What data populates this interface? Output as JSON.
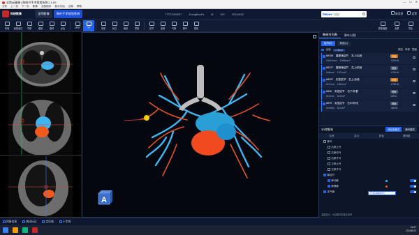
{
  "window": {
    "title": "全院云健康 | 肺结节手术规划系统 2.1.69",
    "controls": [
      "—",
      "☐",
      "✕"
    ]
  },
  "menu": [
    "文件",
    "上一页",
    "下一页",
    "影像",
    "全部插件",
    "显示对话",
    "注释",
    "帮助"
  ],
  "brand": {
    "name": "科研影像"
  },
  "app_tabs": [
    {
      "label": "全院影像"
    },
    {
      "label": "胸外手术规划系统"
    }
  ],
  "patient": {
    "id": "TT2C3493037",
    "name": "ZhangBaoFa",
    "sex": "M",
    "age": "45Y",
    "date": "2024/8/20"
  },
  "search": {
    "brand": "Meeex",
    "placeholder": "搜索..."
  },
  "top_right": [
    {
      "label": "新消息"
    },
    {
      "label": "设置"
    }
  ],
  "toolbar": [
    {
      "label": "布局"
    },
    {
      "label": "窗宽窗位"
    },
    {
      "label": "平移"
    },
    {
      "label": "缩放"
    },
    {
      "label": "旋转"
    },
    {
      "label": "反色"
    },
    {
      "label": "MPR"
    },
    {
      "label": "VR"
    },
    {
      "label": "测量"
    },
    {
      "label": "标注"
    },
    {
      "label": "裁剪"
    },
    {
      "label": "重置"
    },
    {
      "label": "结节"
    },
    {
      "label": "血管"
    },
    {
      "label": "气管"
    },
    {
      "label": "肺叶"
    },
    {
      "label": "报告"
    }
  ],
  "toolbar_right": [
    {
      "label": "模型截图"
    },
    {
      "label": "全屏"
    },
    {
      "label": "导出"
    }
  ],
  "mpr_views": [
    {
      "label": "Axial"
    },
    {
      "label": "Coronal"
    },
    {
      "label": "Sagittal"
    }
  ],
  "right_panel": {
    "tabs": [
      "肺结节列表",
      "肺叶分割"
    ],
    "subtabs": [
      "结节(8)",
      "肿瘤(1)"
    ],
    "filter": {
      "label": "全选",
      "chip": ">=3mm",
      "sort_a": "风险",
      "sort_b": "体积",
      "sort_c": "层面"
    },
    "nodules": [
      {
        "id": "IM108",
        "type": "磨玻璃结节",
        "lobe": "右上/后段",
        "risk": "中危",
        "size": "15x11mm",
        "vol": "1096mm³",
        "hu": "-525HU"
      },
      {
        "id": "IM127",
        "type": "磨玻璃结节",
        "lobe": "左上/前段",
        "risk": "低危",
        "size": "9x6mm",
        "vol": "197mm³",
        "hu": "-678HU"
      },
      {
        "id": "IM107",
        "type": "实性结节",
        "lobe": "右上/后段",
        "risk": "中危",
        "size": "8x7mm",
        "vol": "180mm³",
        "hu": "-676HU"
      },
      {
        "id": "IM40",
        "type": "实性结节",
        "lobe": "右下/外基",
        "risk": "低危",
        "size": "5x4mm",
        "vol": "52mm³",
        "hu": "18HU"
      },
      {
        "id": "IM75",
        "type": "实性结节",
        "lobe": "右中/外段",
        "risk": "低危",
        "size": "5x4mm",
        "vol": "51mm³",
        "hu": "-58HU"
      }
    ]
  },
  "recon": {
    "title": "3D控制台",
    "modes": [
      "体绘制模式",
      "肺叶模式"
    ],
    "columns": [
      "名称",
      "显示",
      "颜色",
      "透明度"
    ],
    "rows": [
      {
        "label": "肺叶",
        "level": 1,
        "color": ""
      },
      {
        "label": "右肺上叶",
        "level": 2,
        "color": "#e05b4a"
      },
      {
        "label": "右肺中叶",
        "level": 2,
        "color": "#f3a43a"
      },
      {
        "label": "右肺下叶",
        "level": 2,
        "color": "#42b4ef"
      },
      {
        "label": "左肺上叶",
        "level": 2,
        "color": "#4fc36a"
      },
      {
        "label": "左肺下叶",
        "level": 2,
        "color": "#c084fc"
      },
      {
        "label": "肺结节",
        "level": 1,
        "color": ""
      },
      {
        "label": "肺动脉",
        "level": 2,
        "color": "#42b4ef"
      },
      {
        "label": "肺静脉",
        "level": 2,
        "color": "#e0532c"
      },
      {
        "label": "支气管",
        "level": 1,
        "color": "#bfbfbf"
      }
    ],
    "tooltip": "TT2C3493037",
    "footer": "温馨提示：AI结果仅供医生参考"
  },
  "status": [
    {
      "label": "四角信息"
    },
    {
      "label": "病灶标记"
    },
    {
      "label": "定位线"
    },
    {
      "label": "十字线"
    }
  ],
  "clock": {
    "time": "15:57",
    "date": "2024/8/20"
  },
  "colors": {
    "accent": "#2563eb",
    "artery": "#42b4ef",
    "vein": "#e0532c",
    "airway": "#bdbdbd",
    "heart": "#f04a1e"
  }
}
